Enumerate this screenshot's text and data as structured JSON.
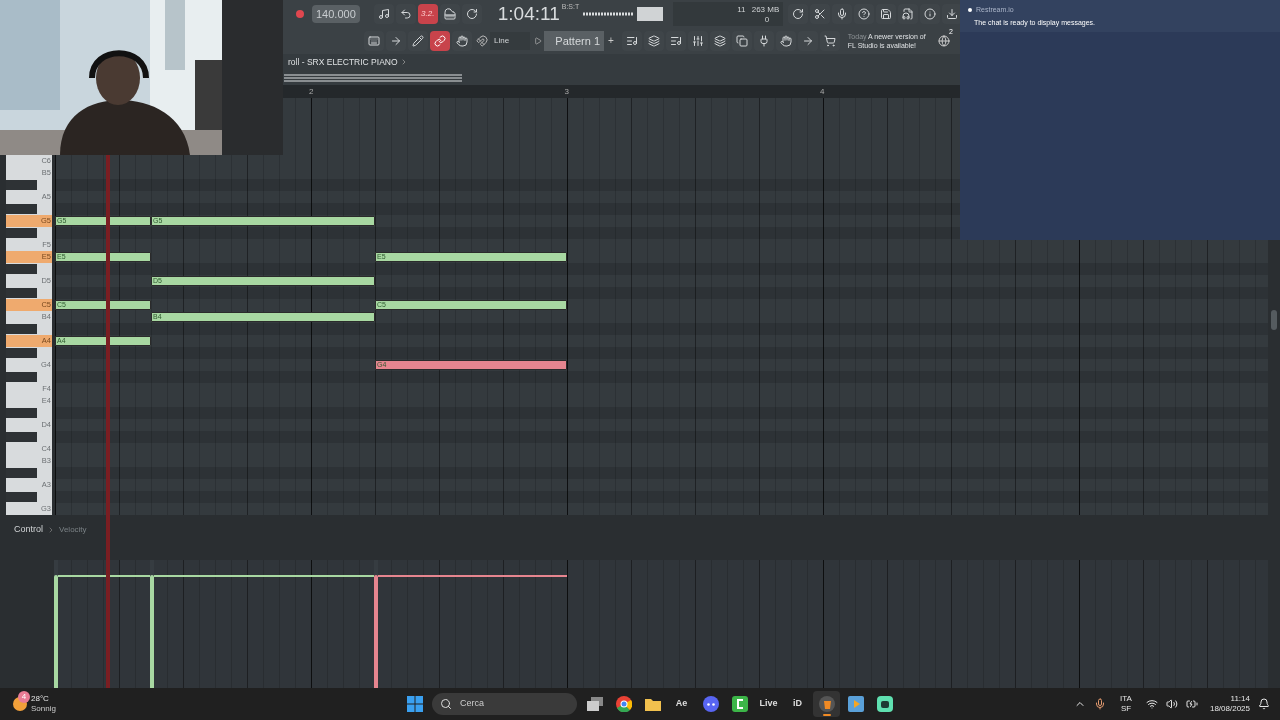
{
  "toolbar": {
    "tempo": "140.000",
    "typing_display": "3.2.",
    "typing_on": true,
    "time": "1:04:11",
    "time_format": "B:S:T",
    "polyphony": "11",
    "memory": "263 MB",
    "voices": "0",
    "link_on": true,
    "snap": "Line",
    "pattern": "Pattern 1",
    "add_pattern": "+",
    "news_date": "Today",
    "news": "A newer version of FL Studio is available!",
    "news_badge": "2"
  },
  "piano_roll": {
    "title": "roll - SRX ELECTRIC PIANO",
    "ruler": [
      "2",
      "3",
      "4"
    ],
    "rows": [
      {
        "kind": "white",
        "label": "C6",
        "highlighted": false
      },
      {
        "kind": "white",
        "label": "B5",
        "highlighted": false
      },
      {
        "kind": "black",
        "highlighted": false
      },
      {
        "kind": "white",
        "label": "A5",
        "highlighted": false
      },
      {
        "kind": "black",
        "highlighted": false
      },
      {
        "kind": "white",
        "label": "G5",
        "highlighted": true,
        "cells": [
          {
            "label": "G5",
            "color": "#a8d8a2"
          },
          {
            "label": "G5",
            "color": "#a8d8a2"
          },
          null
        ]
      },
      {
        "kind": "black",
        "highlighted": false
      },
      {
        "kind": "white",
        "label": "F5",
        "highlighted": false
      },
      {
        "kind": "white",
        "label": "E5",
        "highlighted": true,
        "cells": [
          {
            "label": "E5",
            "color": "#a8d8a2"
          },
          null,
          {
            "label": "E5",
            "color": "#a8d8a2"
          }
        ]
      },
      {
        "kind": "black",
        "highlighted": false
      },
      {
        "kind": "white",
        "label": "D5",
        "highlighted": false,
        "cells": [
          null,
          {
            "label": "D5",
            "color": "#a8d8a2"
          },
          null
        ]
      },
      {
        "kind": "black",
        "highlighted": false
      },
      {
        "kind": "white",
        "label": "C5",
        "highlighted": true,
        "cells": [
          {
            "label": "C5",
            "color": "#a8d8a2"
          },
          null,
          {
            "label": "C5",
            "color": "#a8d8a2"
          }
        ]
      },
      {
        "kind": "white",
        "label": "B4",
        "highlighted": false,
        "cells": [
          null,
          {
            "label": "B4",
            "color": "#a8d8a2"
          },
          null
        ]
      },
      {
        "kind": "black",
        "highlighted": false
      },
      {
        "kind": "white",
        "label": "A4",
        "highlighted": true,
        "cells": [
          {
            "label": "A4",
            "color": "#a8d8a2"
          },
          null,
          null
        ]
      },
      {
        "kind": "black",
        "highlighted": false
      },
      {
        "kind": "white",
        "label": "G4",
        "highlighted": false,
        "cells": [
          null,
          null,
          {
            "label": "G4",
            "color": "#e6858f"
          }
        ]
      },
      {
        "kind": "black",
        "highlighted": false
      },
      {
        "kind": "white",
        "label": "F4",
        "highlighted": false
      },
      {
        "kind": "white",
        "label": "E4",
        "highlighted": false
      },
      {
        "kind": "black",
        "highlighted": false
      },
      {
        "kind": "white",
        "label": "D4",
        "highlighted": false
      },
      {
        "kind": "black",
        "highlighted": false
      },
      {
        "kind": "white",
        "label": "C4",
        "highlighted": false
      },
      {
        "kind": "white",
        "label": "B3",
        "highlighted": false
      },
      {
        "kind": "black",
        "highlighted": false
      },
      {
        "kind": "white",
        "label": "A3",
        "highlighted": false
      },
      {
        "kind": "black",
        "highlighted": false
      },
      {
        "kind": "white",
        "label": "G3",
        "highlighted": false
      }
    ],
    "control": {
      "label": "Control",
      "target": "Velocity"
    },
    "velocity": [
      {
        "level": 0.88,
        "color": "#a8d8a2"
      },
      {
        "level": 0.88,
        "color": "#a8d8a2"
      },
      {
        "level": 0.88,
        "color": "#e6858f"
      }
    ]
  },
  "chat": {
    "sender": "Restream.io",
    "message": "The chat is ready to display messages."
  },
  "taskbar": {
    "weather_badge": "4",
    "temperature": "28°C",
    "condition": "Sonnig",
    "search_placeholder": "Cerca",
    "apps": [
      {
        "kind": "windows",
        "selected": false
      },
      {
        "kind": "taskview",
        "selected": false
      },
      {
        "kind": "browser",
        "selected": false
      },
      {
        "kind": "folder",
        "selected": false
      },
      {
        "kind": "text",
        "label": "Ae",
        "selected": false
      },
      {
        "kind": "chat",
        "selected": false
      },
      {
        "kind": "green",
        "selected": false
      },
      {
        "kind": "text",
        "label": "Live",
        "selected": false
      },
      {
        "kind": "text",
        "label": "iD",
        "selected": false
      },
      {
        "kind": "fruit",
        "selected": true
      },
      {
        "kind": "player",
        "selected": false
      },
      {
        "kind": "bot",
        "selected": false
      }
    ],
    "language": "ITA",
    "layout": "SF",
    "time": "11:14",
    "date": "18/08/2025"
  }
}
